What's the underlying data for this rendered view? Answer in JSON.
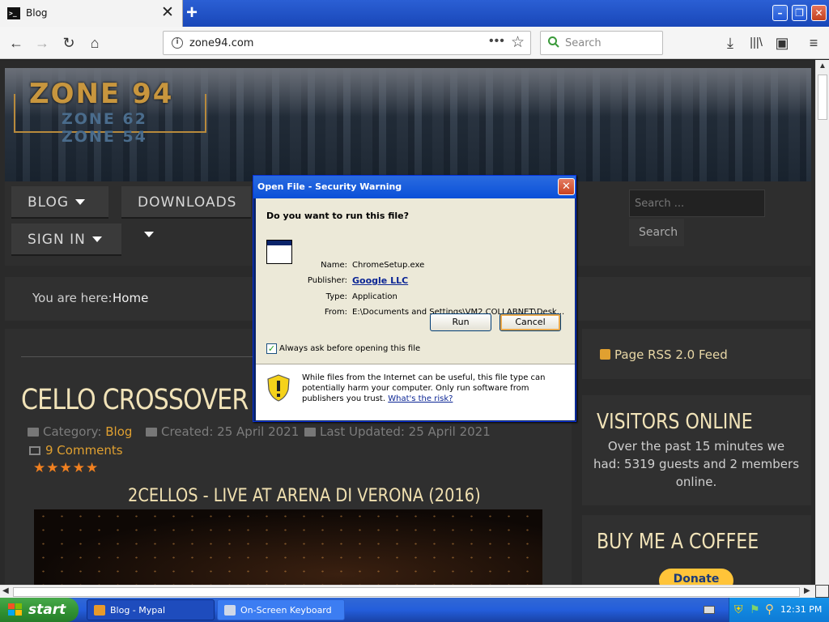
{
  "browser": {
    "tab": {
      "title": "Blog",
      "favicon": "terminal-favicon"
    },
    "new_tab_label": "+",
    "address": "zone94.com",
    "search_placeholder": "Search",
    "url_more": "•••"
  },
  "site": {
    "logo_main": "ZONE 94",
    "logo_sub1": "ZONE 62",
    "logo_sub2": "ZONE 54",
    "menu": [
      {
        "label": "BLOG"
      },
      {
        "label": "DOWNLOADS"
      },
      {
        "label": "SIGN IN"
      }
    ],
    "search_placeholder": "Search ...",
    "search_button": "Search",
    "breadcrumb_label": "You are here:",
    "breadcrumb_home": "Home",
    "article": {
      "title": "CELLO CROSSOVER M",
      "category_label": "Category:",
      "category": "Blog",
      "created": "Created: 25 April 2021",
      "updated": "Last Updated: 25 April 2021",
      "comments": "9 Comments",
      "rating": 5,
      "subheading": "2CELLOS - LIVE AT ARENA DI VERONA (2016)"
    },
    "sidebar": {
      "rss": "Page RSS 2.0 Feed",
      "visitors_heading": "VISITORS ONLINE",
      "visitors_text": "Over the past 15 minutes we had: 5319 guests and 2 members online.",
      "coffee_heading": "BUY ME A COFFEE",
      "donate": "Donate"
    }
  },
  "dialog": {
    "title": "Open File - Security Warning",
    "question": "Do you want to run this file?",
    "fields": {
      "name_label": "Name:",
      "name": "ChromeSetup.exe",
      "publisher_label": "Publisher:",
      "publisher": "Google LLC",
      "type_label": "Type:",
      "type": "Application",
      "from_label": "From:",
      "from": "E:\\Documents and Settings\\VM2.COLLABNET\\Desk..."
    },
    "run_button": "Run",
    "cancel_button": "Cancel",
    "checkbox_label": "Always ask before opening this file",
    "checkbox_checked": true,
    "warning": "While files from the Internet can be useful, this file type can potentially harm your computer. Only run software from publishers you trust.",
    "risk_link": "What's the risk?"
  },
  "taskbar": {
    "start": "start",
    "tasks": [
      {
        "label": "Blog - Mypal",
        "active": true
      },
      {
        "label": "On-Screen Keyboard",
        "active": false
      }
    ],
    "clock": "12:31 PM"
  },
  "colors": {
    "accent": "#e0a030",
    "heading": "#f1e3b8",
    "xp_blue": "#0a50d8"
  }
}
